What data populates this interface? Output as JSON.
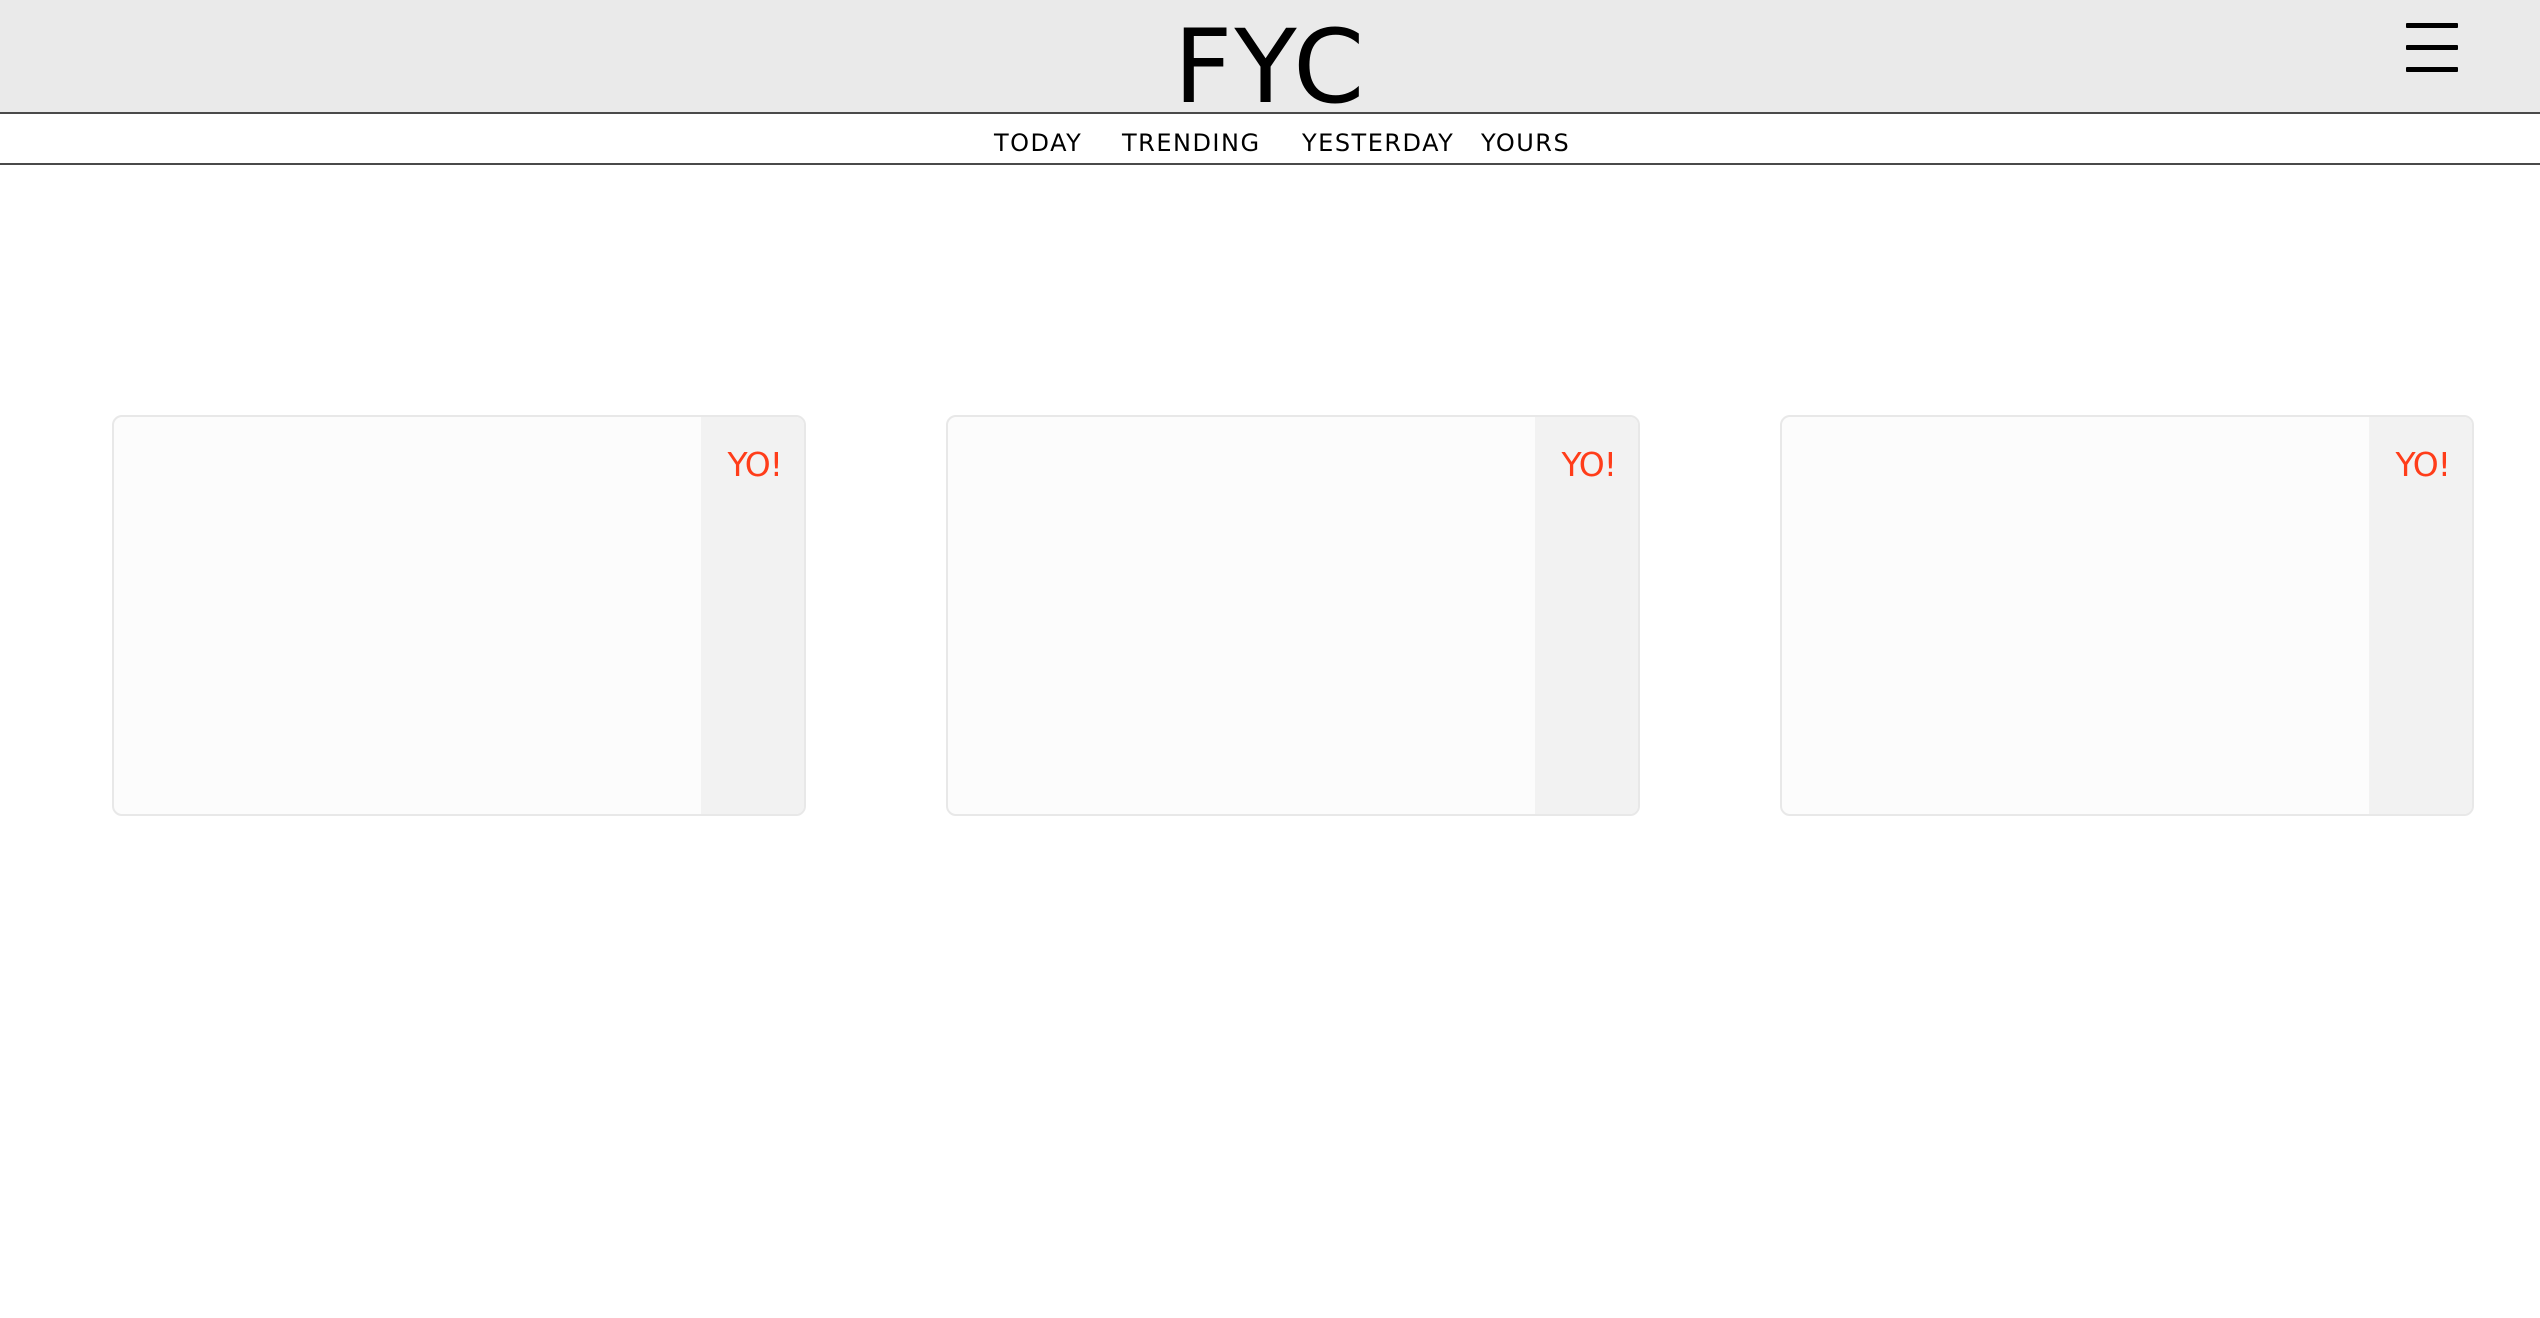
{
  "header": {
    "logo": "FYC",
    "menu_icon": "hamburger-menu-icon"
  },
  "nav": {
    "items": [
      {
        "label": "TODAY"
      },
      {
        "label": "TRENDING"
      },
      {
        "label": "YESTERDAY"
      },
      {
        "label": "YOURS"
      }
    ]
  },
  "cards": [
    {
      "action_label": "YO!"
    },
    {
      "action_label": "YO!"
    },
    {
      "action_label": "YO!"
    }
  ],
  "colors": {
    "header_bg": "#eaeaea",
    "accent": "#ff3d1a",
    "card_bg": "#fcfcfc",
    "card_side_bg": "#f2f2f2"
  }
}
